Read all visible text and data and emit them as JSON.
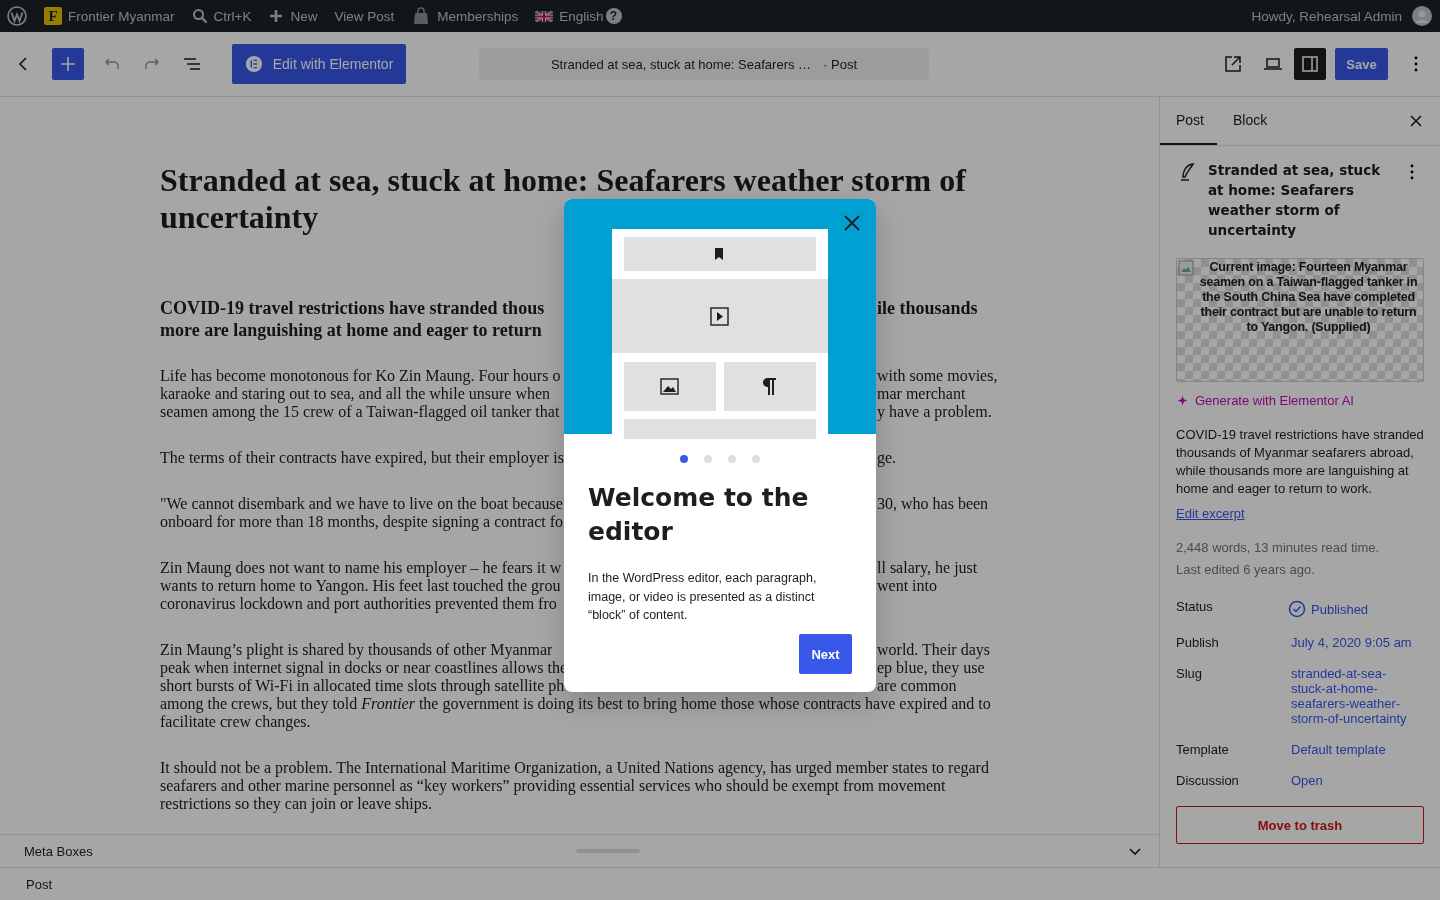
{
  "admin_bar": {
    "items": [
      {
        "kind": "wp-logo"
      },
      {
        "kind": "site",
        "badge": "F",
        "label": "Frontier Myanmar"
      },
      {
        "kind": "search",
        "label": "Ctrl+K"
      },
      {
        "kind": "new",
        "label": "New"
      },
      {
        "kind": "link",
        "label": "View Post"
      },
      {
        "kind": "memberships",
        "label": "Memberships"
      },
      {
        "kind": "language",
        "label": "English",
        "help": "?"
      }
    ],
    "account": "Howdy, Rehearsal Admin"
  },
  "toolbar": {
    "elementor_button": "Edit with Elementor",
    "document_title": "Stranded at sea, stuck at home: Seafarers …",
    "document_type": "· Post",
    "settings_toggle": {
      "pressed": true
    },
    "save": "Save"
  },
  "editor": {
    "title_lines": [
      "Stranded at sea, stuck at home: Seafarers weather storm of",
      "uncertainty"
    ],
    "blocks": [
      {
        "kind": "lead",
        "lines": [
          {
            "left": "COVID-19 travel restrictions have stranded thous",
            "right": "ile thousands"
          },
          {
            "left": "more are languishing at home and eager to return"
          }
        ]
      },
      {
        "kind": "paragraph",
        "lines": [
          {
            "left": "Life has become monotonous for Ko Zin Maung. Four hours o",
            "right": "with some movies,"
          },
          {
            "left": "karaoke and staring out to sea, and all the while unsure when",
            "right": "mar merchant"
          },
          {
            "left": "seamen among the 15 crew of a Taiwan-flagged oil tanker that",
            "right": "y have a problem."
          }
        ]
      },
      {
        "kind": "paragraph",
        "lines": [
          {
            "left": "The terms of their contracts have expired, but their employer is",
            "right": "ge."
          }
        ]
      },
      {
        "kind": "paragraph",
        "lines": [
          {
            "left": "\"We cannot disembark and we have to live on the boat because",
            "right": "30, who has been"
          },
          {
            "left": "onboard for more than 18 months, despite signing a contract fo"
          }
        ]
      },
      {
        "kind": "paragraph",
        "lines": [
          {
            "left": "Zin Maung does not want to name his employer – he fears it w",
            "right": "ll salary, he just"
          },
          {
            "left": "wants to return home to Yangon. His feet last touched the grou",
            "right": "went into"
          },
          {
            "left": "coronavirus lockdown and port authorities prevented them fro"
          }
        ]
      },
      {
        "kind": "paragraph",
        "lines": [
          {
            "left": "Zin Maung’s plight is shared by thousands of other Myanmar",
            "right": "world. Their days"
          },
          {
            "left": "peak when internet signal in docks or near coastlines allows the",
            "right": "ep blue, they use"
          },
          {
            "left": "short bursts of Wi-Fi in allocated time slots through satellite ph",
            "right": "are common"
          },
          {
            "left": "among the crews, but they told *Frontier* the government is doing its best to bring home those whose contracts have expired and to"
          },
          {
            "left": "facilitate crew changes."
          }
        ]
      },
      {
        "kind": "paragraph",
        "lines": [
          {
            "left": "It should not be a problem. The International Maritime Organization, a United Nations agency, has urged member states to regard"
          },
          {
            "left": "seafarers and other marine personnel as “key workers” providing essential services who should be exempt from movement"
          },
          {
            "left": "restrictions so they can join or leave ships."
          }
        ]
      }
    ]
  },
  "meta_boxes": {
    "label": "Meta Boxes"
  },
  "footer": {
    "breadcrumb": "Post"
  },
  "sidebar": {
    "tabs": [
      {
        "label": "Post",
        "selected": true
      },
      {
        "label": "Block",
        "selected": false
      }
    ],
    "post_title": "Stranded at sea, stuck at home: Seafarers weather storm of uncertainty",
    "featured_image_alt": "Current image: Fourteen Myanmar seamen on a Taiwan-flagged tanker in the South China Sea have completed their contract but are unable to return to Yangon. (Supplied)",
    "generate_ai": "Generate with Elementor AI",
    "excerpt": "COVID-19 travel restrictions have stranded thousands of Myanmar seafarers abroad, while thousands more are languishing at home and eager to return to work.",
    "edit_excerpt": "Edit excerpt",
    "stats": [
      "2,448 words, 13 minutes read time.",
      "Last edited 6 years ago."
    ],
    "fields": [
      {
        "label": "Status",
        "value": "Published",
        "kind": "status"
      },
      {
        "label": "Publish",
        "value": "July 4, 2020 9:05 am",
        "kind": "link"
      },
      {
        "label": "Slug",
        "value": "stranded-at-sea-stuck-at-home-seafarers-weather-storm-of-uncertainty",
        "kind": "link"
      },
      {
        "label": "Template",
        "value": "Default template",
        "kind": "link"
      },
      {
        "label": "Discussion",
        "value": "Open",
        "kind": "link"
      }
    ],
    "trash": "Move to trash"
  },
  "modal": {
    "pages": [
      {
        "selected": true
      },
      {
        "selected": false
      },
      {
        "selected": false
      },
      {
        "selected": false
      }
    ],
    "heading": "Welcome to the editor",
    "body": "In the WordPress editor, each paragraph, image, or video is presented as a distinct “block” of content.",
    "next": "Next"
  }
}
